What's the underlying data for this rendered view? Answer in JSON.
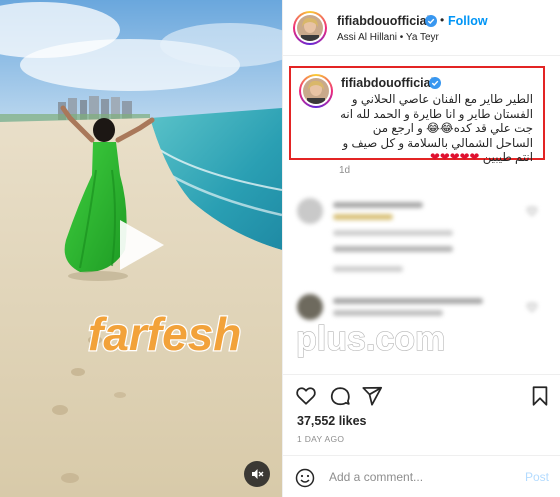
{
  "post": {
    "author": "fifiabdouofficial",
    "follow_label": "Follow",
    "separator": "•",
    "audio_line": "Assi Al Hillani • Ya Teyr",
    "caption": "الطير طاير مع الفنان عاصي الحلاني و الفستان طاير و انا طايرة و الحمد لله انه جت علي قد كده😂😂 و ارجع من الساحل الشمالي بالسلامة و كل صيف و انتم طيبين",
    "caption_hearts": "❤❤❤❤❤",
    "time_ago": "1d",
    "likes": "37,552 likes",
    "posted": "1 DAY AGO"
  },
  "comment_box": {
    "placeholder": "Add a comment...",
    "post_label": "Post"
  },
  "watermark": {
    "brand": "farfesh",
    "suffix": "plus.com"
  },
  "colors": {
    "accent": "#0095f6",
    "highlight_border": "#e32424",
    "watermark_orange": "#f2a23a",
    "heart_red": "#e0102f",
    "dress_green": "#2eb82e"
  },
  "icons": {
    "verified": "verified-badge-icon",
    "play": "play-icon",
    "mute": "muted-speaker-icon",
    "like": "heart-outline-icon",
    "comment": "speech-bubble-icon",
    "share": "paper-plane-icon",
    "save": "bookmark-icon",
    "emoji": "smiley-icon"
  }
}
